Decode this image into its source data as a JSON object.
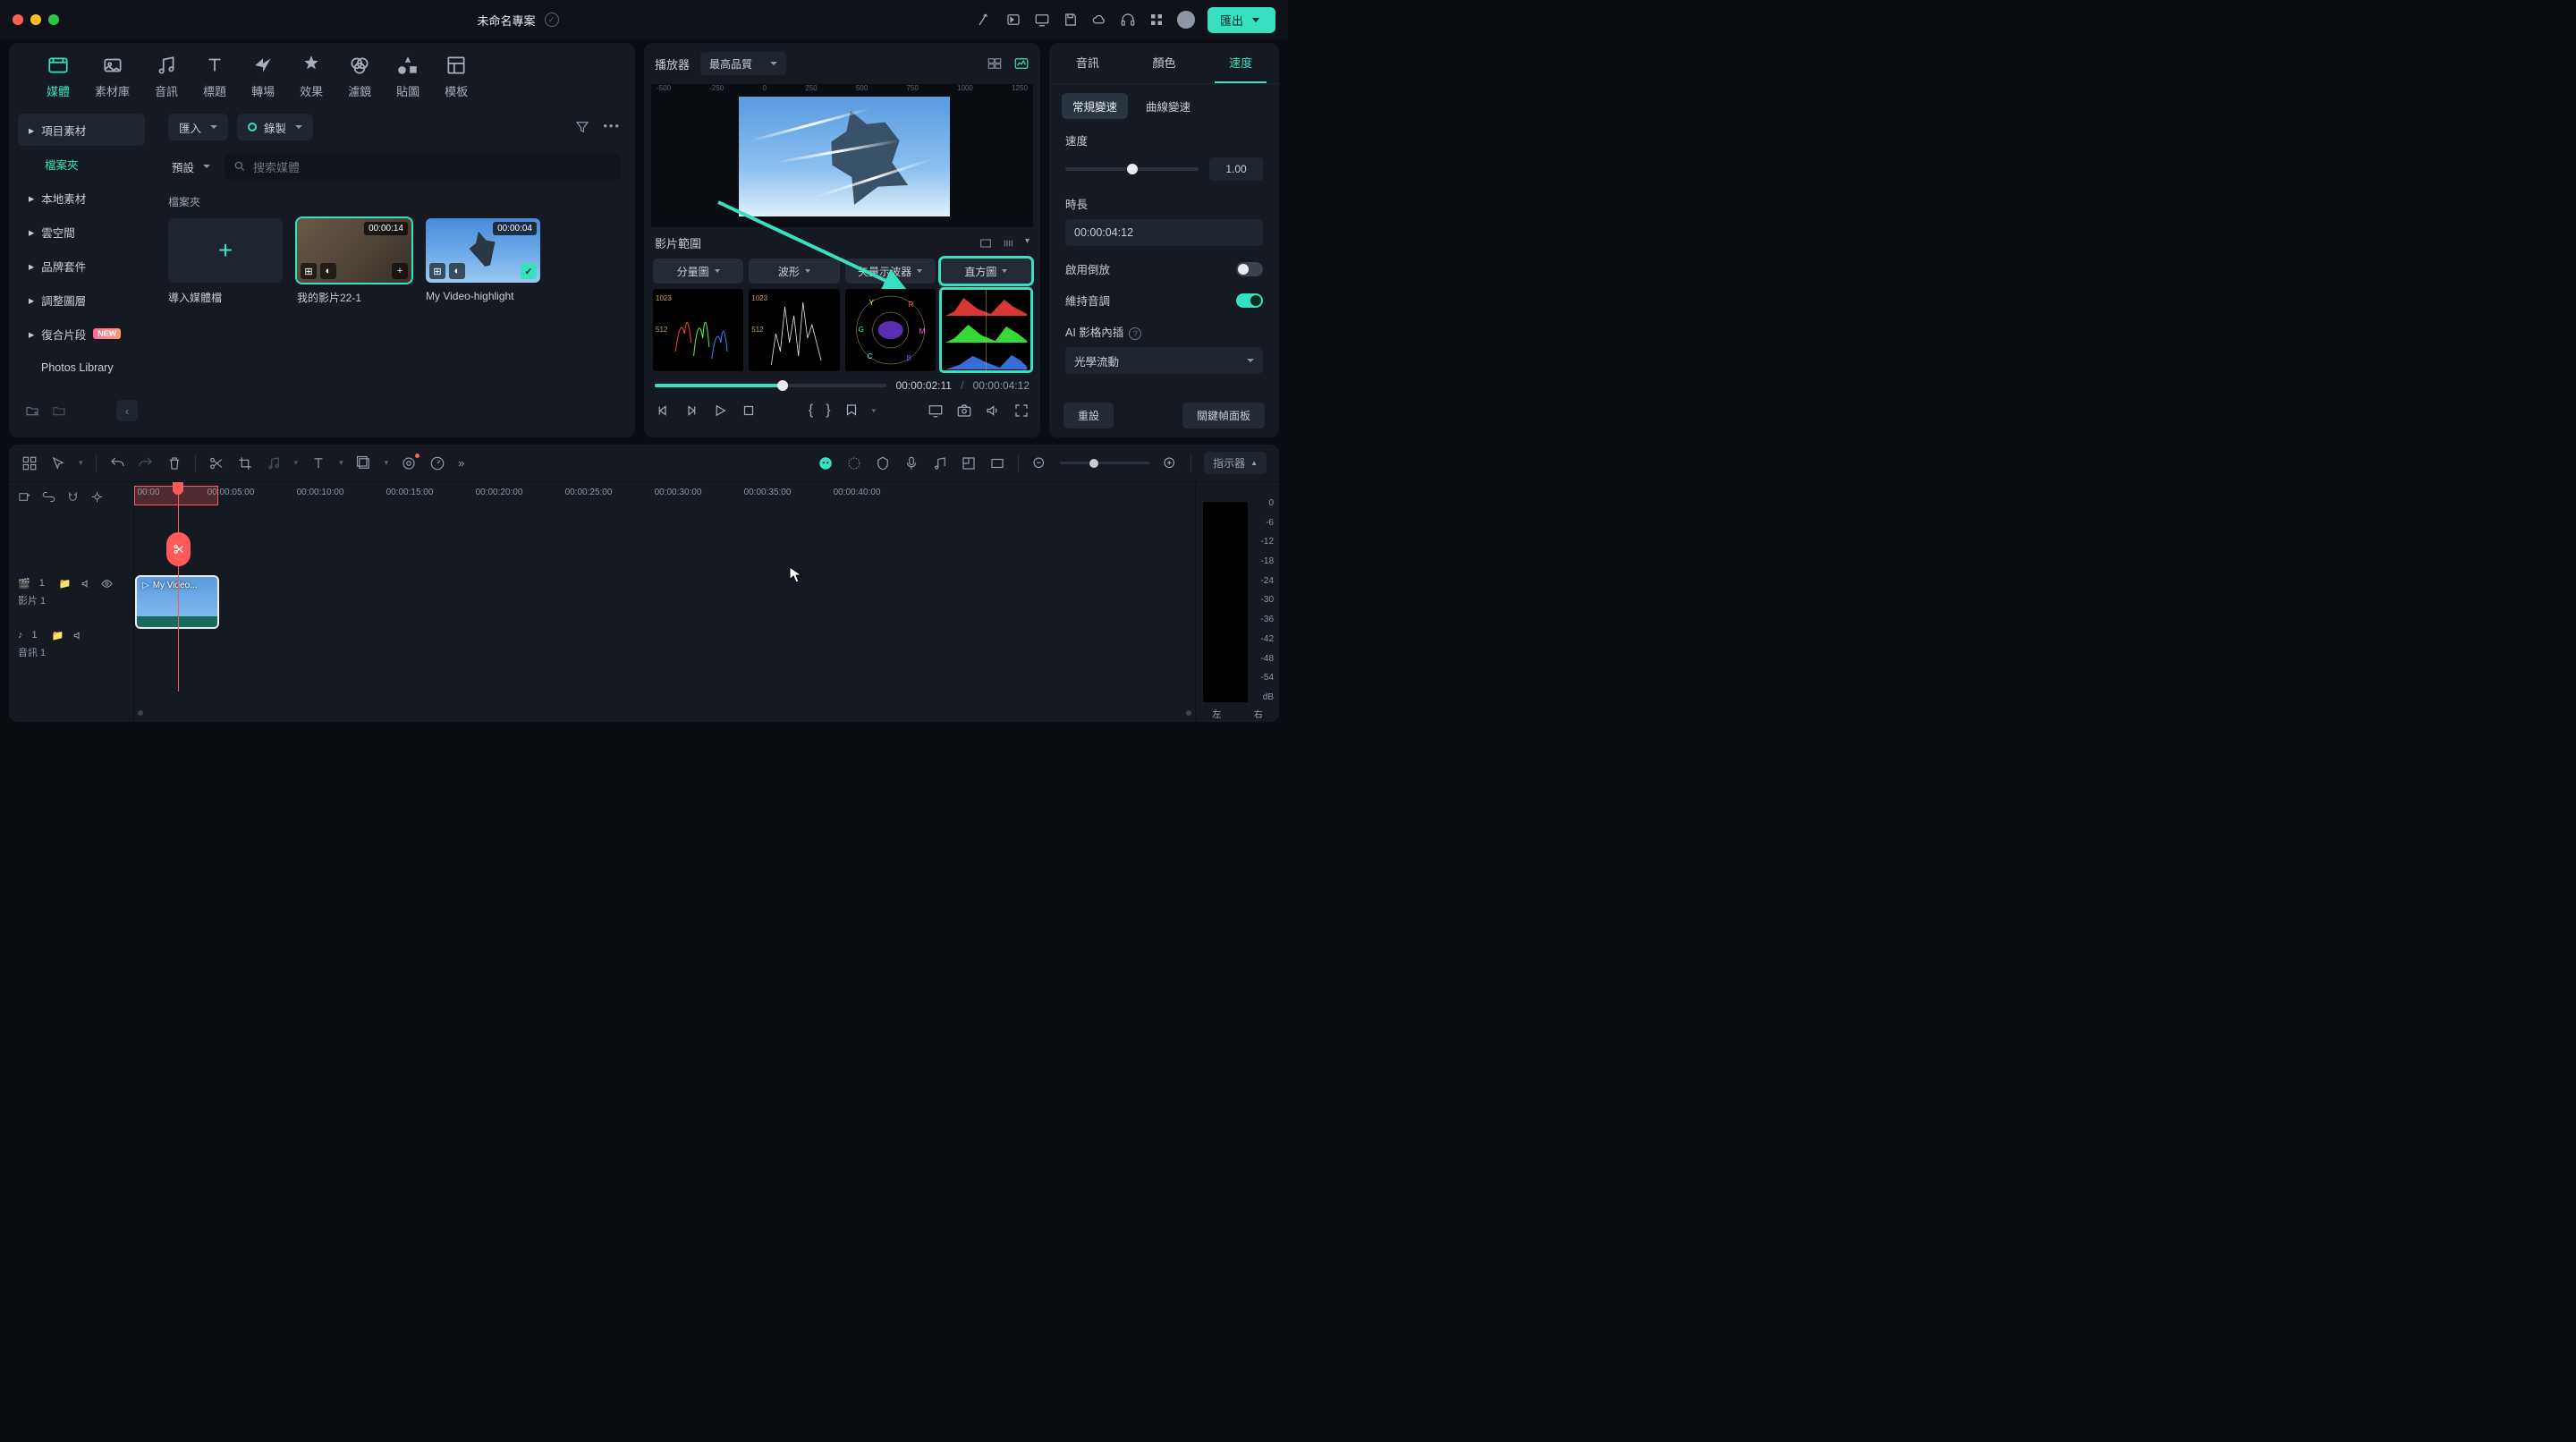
{
  "title": "未命名專案",
  "export_label": "匯出",
  "top_tabs": [
    {
      "label": "媒體",
      "active": true
    },
    {
      "label": "素材庫"
    },
    {
      "label": "音訊"
    },
    {
      "label": "標題"
    },
    {
      "label": "轉場"
    },
    {
      "label": "效果"
    },
    {
      "label": "濾鏡"
    },
    {
      "label": "貼圖"
    },
    {
      "label": "模板"
    }
  ],
  "import_btn": "匯入",
  "record_btn": "錄製",
  "preset_dd": "預設",
  "search_placeholder": "搜索媒體",
  "sidebar": {
    "items": [
      {
        "label": "項目素材",
        "hov": true
      },
      {
        "label": "檔案夾",
        "active": true
      },
      {
        "label": "本地素材"
      },
      {
        "label": "雲空間"
      },
      {
        "label": "品牌套件"
      },
      {
        "label": "調整圖層"
      },
      {
        "label": "復合片段",
        "new": true
      },
      {
        "label": "Photos Library"
      }
    ]
  },
  "folder_label": "檔案夾",
  "thumbs": [
    {
      "label": "導入媒體檔",
      "type": "add"
    },
    {
      "label": "我的影片22-1",
      "dur": "00:00:14",
      "selected": true,
      "type": "img1"
    },
    {
      "label": "My Video-highlight",
      "dur": "00:00:04",
      "checked": true,
      "type": "img2"
    }
  ],
  "player": {
    "title": "播放器",
    "quality": "最高品質",
    "video_ruler": [
      "-500",
      "-250",
      "0",
      "250",
      "500",
      "750",
      "1000",
      "1250"
    ],
    "scope_title": "影片範圍",
    "scope_tabs": [
      "分量圖",
      "波形",
      "矢量示波器",
      "直方圖"
    ],
    "scope_vals": [
      "1023",
      "512"
    ],
    "cur_time": "00:00:02:11",
    "sep": "/",
    "dur": "00:00:04:12"
  },
  "right": {
    "tabs": [
      "音訊",
      "顏色",
      "速度"
    ],
    "subtabs": [
      "常規變速",
      "曲線變速"
    ],
    "speed_label": "速度",
    "speed_value": "1.00",
    "duration_label": "時長",
    "duration_value": "00:00:04:12",
    "reverse_label": "啟用倒放",
    "pitch_label": "維持音調",
    "ai_label": "AI 影格內插",
    "ai_value": "光學流動",
    "reset": "重設",
    "keyframe": "關鍵幀面板"
  },
  "timeline": {
    "indicator_btn": "指示器",
    "ruler_marks": [
      "00:00",
      "00:00:05:00",
      "00:00:10:00",
      "00:00:15:00",
      "00:00:20:00",
      "00:00:25:00",
      "00:00:30:00",
      "00:00:35:00",
      "00:00:40:00"
    ],
    "track_video": "影片 1",
    "track_audio": "音訊 1",
    "clip_label": "My Video...",
    "meter_vals": [
      "0",
      "-6",
      "-12",
      "-18",
      "-24",
      "-30",
      "-36",
      "-42",
      "-48",
      "-54",
      "dB"
    ],
    "meter_foot": [
      "左",
      "右"
    ]
  }
}
